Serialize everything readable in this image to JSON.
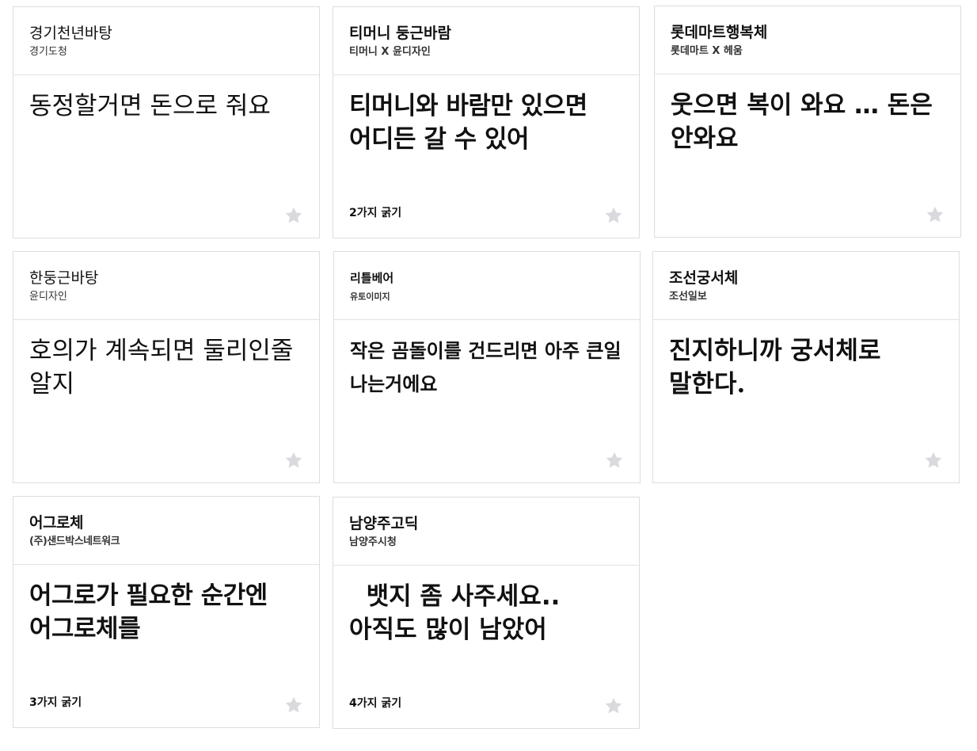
{
  "colors": {
    "star": "#d9d9de",
    "border": "#dddddd"
  },
  "cards": [
    {
      "name": "경기천년바탕",
      "maker": "경기도청",
      "sample": "동정할거면 돈으로 줘요",
      "weights": ""
    },
    {
      "name": "티머니 둥근바람",
      "maker": "티머니 X 윤디자인",
      "sample": "티머니와 바람만 있으면 어디든 갈 수 있어",
      "weights": "2가지 굵기"
    },
    {
      "name": "롯데마트행복체",
      "maker": "롯데마트 X 헤움",
      "sample": "웃으면 복이 와요 … 돈은 안와요",
      "weights": ""
    },
    {
      "name": "한둥근바탕",
      "maker": "윤디자인",
      "sample": "호의가 계속되면 둘리인줄 알지",
      "weights": ""
    },
    {
      "name": "리틀베어",
      "maker": "유토이미지",
      "sample": "작은 곰돌이를 건드리면 아주 큰일 나는거에요",
      "weights": ""
    },
    {
      "name": "조선궁서체",
      "maker": "조선일보",
      "sample": "진지하니까 궁서체로 말한다.",
      "weights": ""
    },
    {
      "name": "어그로체",
      "maker": "(주)샌드박스네트워크",
      "sample": "어그로가 필요한 순간엔 어그로체를",
      "weights": "3가지 굵기"
    },
    {
      "name": "남양주고딕",
      "maker": "남양주시청",
      "sample": "  뱃지 좀 사주세요.. 아직도 많이 남았어",
      "weights": "4가지 굵기"
    }
  ]
}
